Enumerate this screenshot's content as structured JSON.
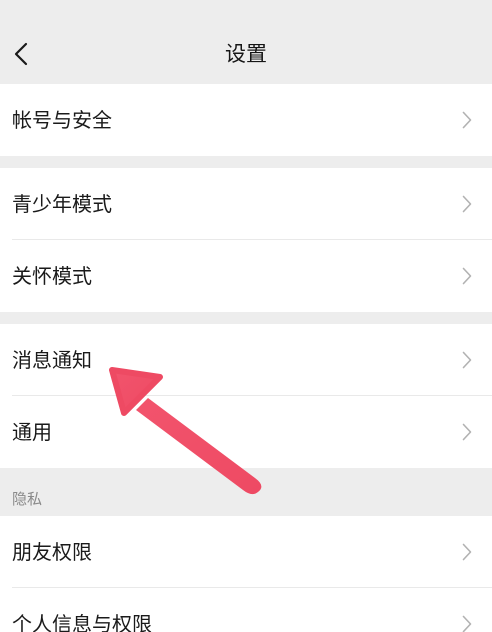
{
  "header": {
    "title": "设置",
    "back_icon": "chevron-left-icon"
  },
  "groups": [
    {
      "items": [
        {
          "label": "帐号与安全"
        }
      ]
    },
    {
      "items": [
        {
          "label": "青少年模式"
        },
        {
          "label": "关怀模式"
        }
      ]
    },
    {
      "items": [
        {
          "label": "消息通知"
        },
        {
          "label": "通用"
        }
      ]
    },
    {
      "section_title": "隐私",
      "items": [
        {
          "label": "朋友权限"
        },
        {
          "label": "个人信息与权限"
        }
      ]
    }
  ],
  "colors": {
    "background": "#ededed",
    "row_background": "#ffffff",
    "text": "#1a1a1a",
    "chevron": "#b2b2b2",
    "annotation_arrow": "#f0526b"
  }
}
